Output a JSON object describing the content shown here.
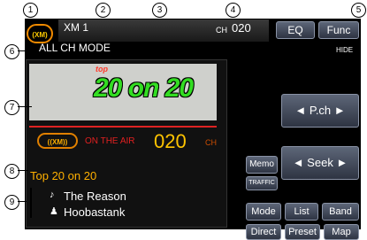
{
  "callouts": [
    "1",
    "2",
    "3",
    "4",
    "5",
    "6",
    "7",
    "8",
    "9"
  ],
  "header": {
    "band": "XM 1",
    "ch_label": "CH",
    "ch_value": "020",
    "eq": "EQ",
    "func": "Func",
    "hide": "HIDE",
    "mode": "ALL CH MODE"
  },
  "logos": {
    "xm": "(XM)",
    "sxm": "((XM))"
  },
  "art": {
    "top": "top",
    "text": "20 on 20"
  },
  "onair": {
    "label": "ON THE AIR",
    "channel": "020",
    "unit": "CH"
  },
  "track": {
    "title": "Top 20 on 20",
    "song": "The Reason",
    "artist": "Hoobastank"
  },
  "buttons": {
    "pch": "◄  P.ch  ►",
    "memo": "Memo",
    "traffic": "TRAFFIC",
    "seek": "◄  Seek  ►",
    "mode": "Mode",
    "list": "List",
    "band": "Band",
    "direct": "Direct",
    "preset": "Preset",
    "map": "Map"
  },
  "icons": {
    "note": "music-note-icon",
    "person": "artist-icon"
  },
  "colors": {
    "accent": "#ffb000",
    "channel": "#ffc400",
    "onair": "#e02020",
    "art_green": "#33dd22"
  }
}
